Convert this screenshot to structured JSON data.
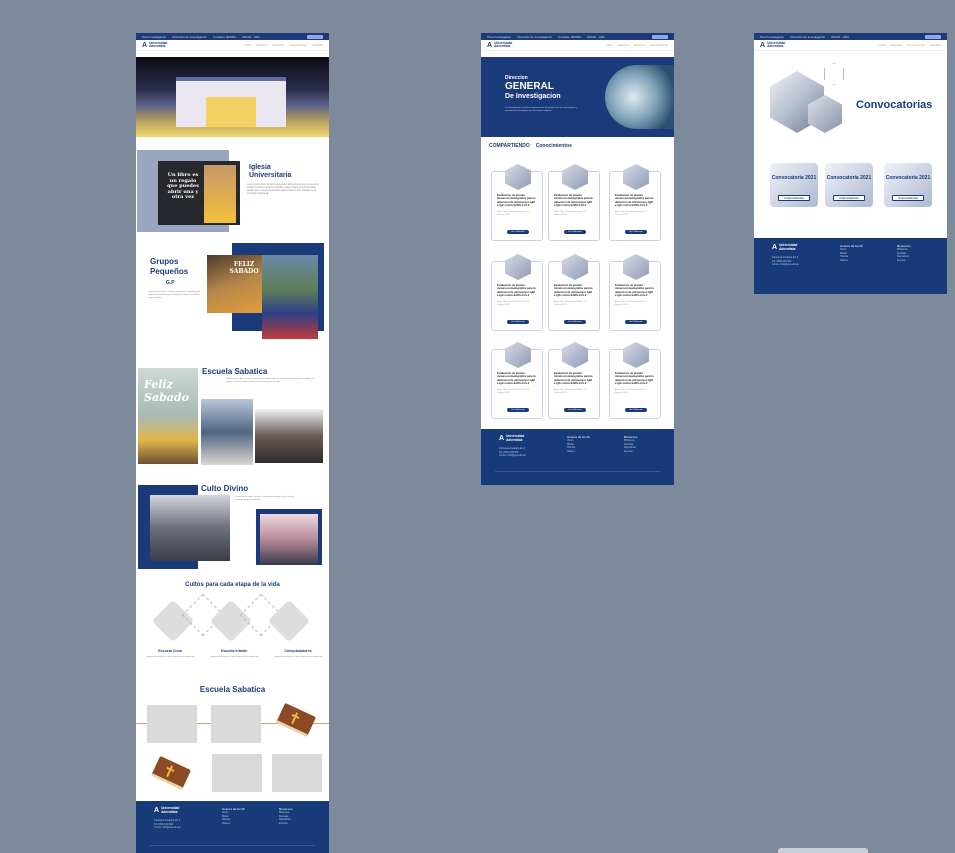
{
  "common": {
    "topbar": [
      "Pixel Investigation",
      "Dirección de investigación",
      "Contacto 000000",
      "INICIO  ·  UPA"
    ],
    "logo": {
      "mark": "A",
      "line1": "Universidad",
      "line2": "Adventista"
    },
    "nav": [
      "Inicio",
      "Nosotros",
      "Servicios",
      "Convocatorias",
      "Contacto"
    ]
  },
  "page1": {
    "iglesia": {
      "title": "Iglesia Universitaria",
      "book_text": "Un libro es un regalo que puedes abrir una y otra vez",
      "body": "Lorem ipsum dolor sit amet consectetur adipiscing elit sed do eiusmod tempor incididunt ut labore et dolore magna aliqua ut enim ad minim veniam quis nostrud exercitation ullamco laboris nisi ut aliquip ex ea commodo consequat."
    },
    "grupos": {
      "title": "Grupos Pequeños",
      "sub": "G.P",
      "banner": "FELIZ SABADO",
      "body": "Lorem ipsum dolor sit amet consectetur adipiscing elit sed do eiusmod tempor incididunt ut labore et dolore magna aliqua."
    },
    "escuela": {
      "title": "Escuela Sabatica",
      "poster": "Feliz Sabado",
      "body": "Lorem ipsum dolor sit amet consectetur adipiscing elit sed do eiusmod tempor incididunt ut labore et dolore magna aliqua ut enim ad minim veniam."
    },
    "culto": {
      "title": "Culto Divino",
      "body": "Lorem ipsum dolor sit amet consectetur adipiscing elit sed do eiusmod tempor incididunt."
    },
    "cultos": {
      "title": "Cultos para cada etapa de la vida",
      "items": [
        {
          "name": "Escuela Cuna",
          "text": "Lorem ipsum dolor sit amet consectetur adipiscing"
        },
        {
          "name": "Escuela Infante",
          "text": "Lorem ipsum dolor sit amet consectetur adipiscing"
        },
        {
          "name": "Conquistadores",
          "text": "Lorem ipsum dolor sit amet consectetur adipiscing"
        }
      ]
    },
    "escuela2": {
      "title": "Escuela Sabatica"
    }
  },
  "page2": {
    "hero": {
      "l1": "Direccion",
      "l2": "GENERAL",
      "l3": "De Investigacion",
      "body": "La investigación científica como proceso de producción de conocimiento y transferencia tecnológica de los nuevos saberes."
    },
    "heading": {
      "a": "COMPARTIENDO",
      "b": "Conocimientos"
    },
    "card": {
      "title": "Evaluacion de prueba inmunocromatografica para la deteccion de anticuerpos IgM e IgG contra SARS-CoV-2",
      "meta": "Autor: Mg. Juan Perez Fecha: 12 Febrero 2021",
      "button": "Ver Publicacion"
    }
  },
  "page3": {
    "title": "Convocatorias",
    "cards": [
      {
        "year": "Convocatoria 2021",
        "button": "Convocatoria"
      },
      {
        "year": "Convocatoria 2021",
        "button": "Convocatoria"
      },
      {
        "year": "Convocatoria 2021",
        "button": "Convocatoria"
      }
    ]
  },
  "footer": {
    "address": [
      "Carretera Arequipa km 6",
      "Tel: (054) 000 000",
      "Correo: info@upa.edu.pe"
    ],
    "col1_title": "Acerca de la UA",
    "col1": [
      "Visión",
      "Misión",
      "Historia",
      "Valores"
    ],
    "col2_title": "Recursos",
    "col2": [
      "Biblioteca",
      "Revistas",
      "Repositorio",
      "Eventos",
      "Convocatorias"
    ]
  }
}
